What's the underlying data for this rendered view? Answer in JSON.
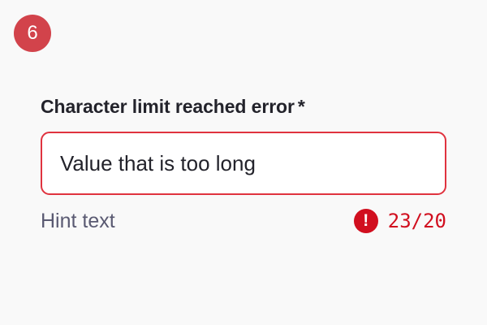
{
  "step_badge": "6",
  "field": {
    "label": "Character limit reached error",
    "required_mark": "*",
    "value": "Value that is too long",
    "hint": "Hint text",
    "error_icon_glyph": "!",
    "counter": "23/20"
  },
  "colors": {
    "badge": "#d2434b",
    "error": "#d10f1f",
    "border_error": "#e0333f",
    "hint": "#5a5a72"
  },
  "icons": {
    "error": "error-circle-icon"
  }
}
